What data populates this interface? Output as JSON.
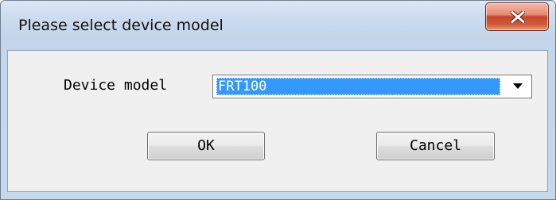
{
  "window": {
    "title": "Please select device model",
    "close_icon": "close-icon"
  },
  "form": {
    "device_model_label": "Device model",
    "device_model_value": "FRT100",
    "dropdown_icon": "chevron-down-icon"
  },
  "buttons": {
    "ok_label": "OK",
    "cancel_label": "Cancel"
  },
  "colors": {
    "selection": "#3399ff",
    "close_button": "#c9452b",
    "title_bar": "#cddcee",
    "client_background": "#f0f0f0"
  }
}
